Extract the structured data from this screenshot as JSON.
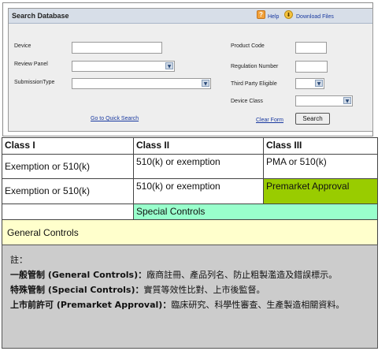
{
  "search": {
    "title": "Search Database",
    "help_label": "Help",
    "download_label": "Download Files",
    "device_label": "Device",
    "review_panel_label": "Review Panel",
    "submission_type_label": "SubmissionType",
    "product_code_label": "Product Code",
    "regulation_number_label": "Regulation Number",
    "third_party_label": "Third Party Eligible",
    "device_class_label": "Device Class",
    "quick_search_link": "Go to Quick Search",
    "clear_form_link": "Clear Form",
    "search_button": "Search"
  },
  "table": {
    "headers": [
      "Class I",
      "Class II",
      "Class III"
    ],
    "row1": [
      "Exemption or 510(k)",
      "510(k) or exemption",
      "PMA or 510(k)"
    ],
    "row2": [
      "Exemption or 510(k)",
      "510(k) or exemption",
      "Premarket Approval"
    ],
    "special_controls": "Special Controls",
    "general_controls": "General Controls"
  },
  "colors": {
    "premarket_green": "#99cc00",
    "special_controls_teal": "#99ffcc",
    "general_controls_yellow": "#ffffcc",
    "notes_gray": "#cccccc",
    "link_blue": "#1a3aa0"
  },
  "notes": {
    "heading": "註：",
    "line1_term": "一般管制 (General Controls)：",
    "line1_text": "廠商註冊、產品列名、防止粗製濫造及錯誤標示。",
    "line2_term": "特殊管制 (Special Controls)：",
    "line2_text": "實質等效性比對、上市後監督。",
    "line3_term": "上市前許可 (Premarket Approval)：",
    "line3_text": "臨床研究、科學性審查、生產製造相關資料。"
  }
}
